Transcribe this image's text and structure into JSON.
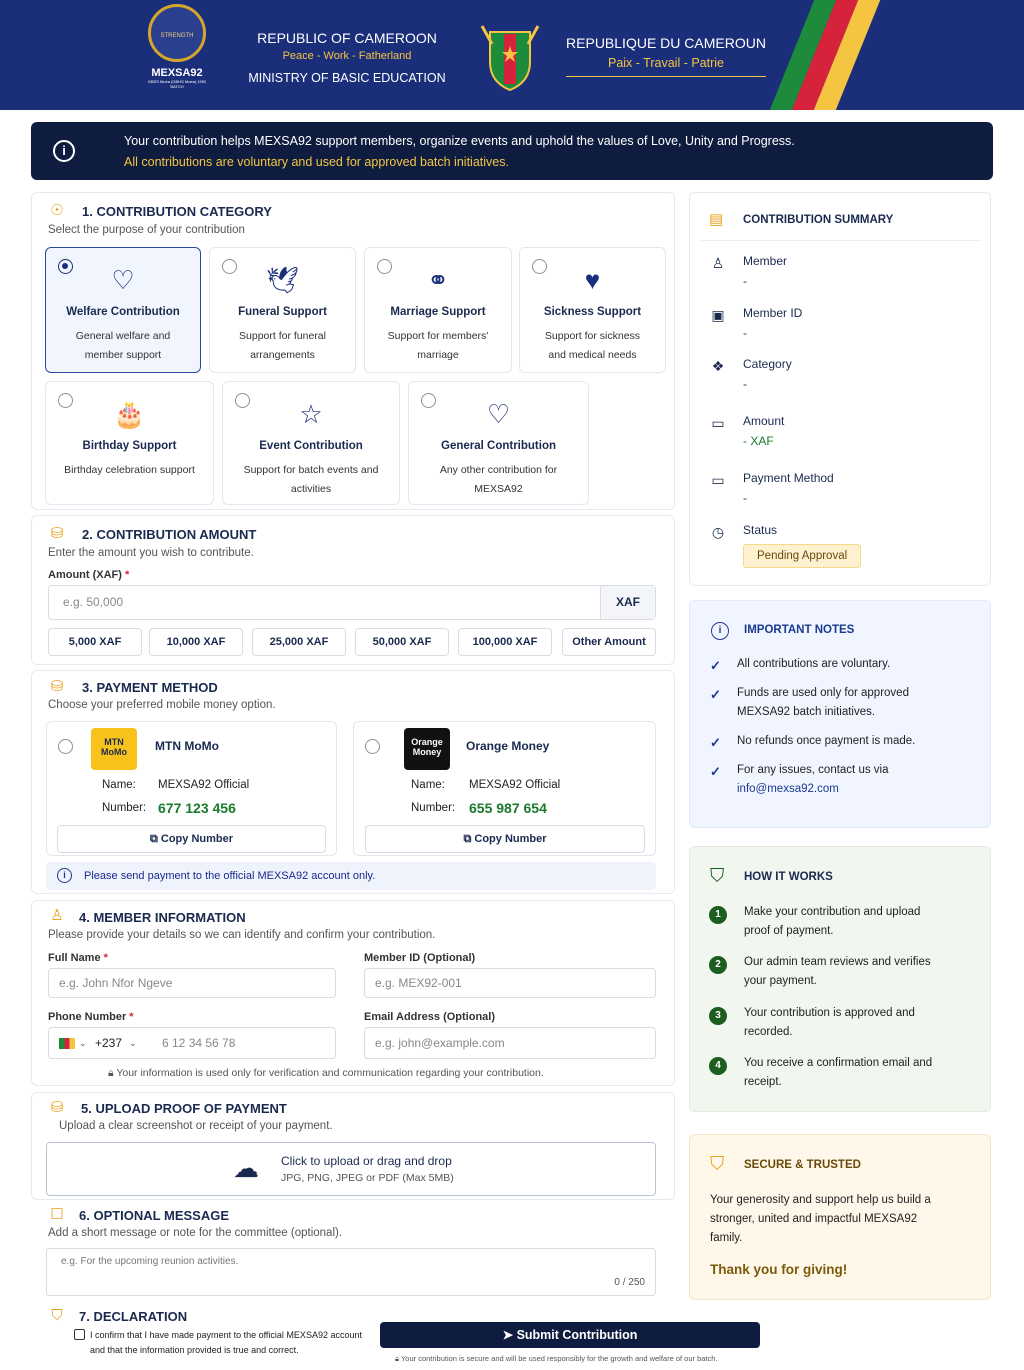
{
  "header": {
    "logo_text": "MEXSA92",
    "logo_sub": "GBSS Muea (GBHS Muea) 1992 BATCH",
    "badge_text": "STRENGTH",
    "en_title": "REPUBLIC OF CAMEROON",
    "en_motto": "Peace - Work - Fatherland",
    "ministry": "MINISTRY OF BASIC EDUCATION",
    "fr_title": "REPUBLIQUE DU CAMEROUN",
    "fr_motto": "Paix - Travail - Patrie",
    "flag_colors": [
      "#1e8a3c",
      "#d6223a",
      "#f5c542"
    ]
  },
  "alert": {
    "icon": "info-icon",
    "line1": "Your contribution helps MEXSA92 support members, organize events and uphold the values of Love, Unity and Progress.",
    "line2": "All contributions are voluntary and used for approved batch initiatives."
  },
  "s1": {
    "title": "1. CONTRIBUTION CATEGORY",
    "subtitle": "Select the purpose of your contribution",
    "categories": [
      {
        "name": "Welfare Contribution",
        "desc": "General welfare and member support",
        "icon": "people-heart-icon",
        "selected": true
      },
      {
        "name": "Funeral Support",
        "desc": "Support for funeral arrangements",
        "icon": "dove-icon"
      },
      {
        "name": "Marriage Support",
        "desc": "Support for members' marriage",
        "icon": "rings-icon"
      },
      {
        "name": "Sickness Support",
        "desc": "Support for sickness and medical needs",
        "icon": "heart-plus-icon"
      },
      {
        "name": "Birthday Support",
        "desc": "Birthday celebration support",
        "icon": "cake-icon"
      },
      {
        "name": "Event Contribution",
        "desc": "Support for batch events and activities",
        "icon": "calendar-star-icon"
      },
      {
        "name": "General Contribution",
        "desc": "Any other contribution for MEXSA92",
        "icon": "hands-heart-icon"
      }
    ]
  },
  "s2": {
    "title": "2. CONTRIBUTION AMOUNT",
    "subtitle": "Enter the amount you wish to contribute.",
    "label": "Amount (XAF)",
    "placeholder": "e.g. 50,000",
    "suffix": "XAF",
    "chips": [
      "5,000 XAF",
      "10,000 XAF",
      "25,000 XAF",
      "50,000 XAF",
      "100,000 XAF",
      "Other Amount"
    ]
  },
  "s3": {
    "title": "3. PAYMENT METHOD",
    "subtitle": "Choose your preferred mobile money option.",
    "name_key": "Name:",
    "number_key": "Number:",
    "copy": "Copy Number",
    "mtn": {
      "logo": "MTN MoMo",
      "name": "MTN MoMo",
      "account": "MEXSA92 Official",
      "number": "677 123 456"
    },
    "orange": {
      "logo": "Orange Money",
      "name": "Orange Money",
      "account": "MEXSA92 Official",
      "number": "655 987 654"
    },
    "note": "Please send payment to the official MEXSA92 account only."
  },
  "s4": {
    "title": "4. MEMBER INFORMATION",
    "subtitle": "Please provide your details so we can identify and confirm your contribution.",
    "fullname_label": "Full Name",
    "fullname_ph": "e.g. John Nfor Ngeve",
    "memberid_label": "Member ID (Optional)",
    "memberid_ph": "e.g. MEX92-001",
    "phone_label": "Phone Number",
    "phone_code": "+237",
    "phone_ph": "6 12 34 56 78",
    "email_label": "Email Address (Optional)",
    "email_ph": "e.g. john@example.com",
    "privacy": "Your information is used only for verification and communication regarding your contribution."
  },
  "s5": {
    "title": "5. UPLOAD PROOF OF PAYMENT",
    "subtitle": "Upload a clear screenshot or receipt of your payment.",
    "drop": "Click to upload or drag and drop",
    "formats": "JPG, PNG, JPEG or PDF (Max 5MB)"
  },
  "s6": {
    "title": "6. OPTIONAL MESSAGE",
    "subtitle": "Add a short message or note for the committee (optional).",
    "placeholder": "e.g. For the upcoming reunion activities.",
    "counter": "0 / 250"
  },
  "s7": {
    "title": "7. DECLARATION",
    "text1": "I confirm that I have made payment to the official MEXSA92 account",
    "text2": "and that the information provided is true and correct."
  },
  "submit": {
    "label": "Submit Contribution",
    "note": "Your contribution is secure and will be used responsibly for the growth and welfare of our batch."
  },
  "summary": {
    "title": "CONTRIBUTION SUMMARY",
    "rows": [
      {
        "key": "Member",
        "val": "-",
        "icon": "user-icon"
      },
      {
        "key": "Member ID",
        "val": "-",
        "icon": "id-card-icon"
      },
      {
        "key": "Category",
        "val": "-",
        "icon": "category-icon"
      },
      {
        "key": "Amount",
        "val": "- XAF",
        "icon": "money-icon"
      },
      {
        "key": "Payment Method",
        "val": "-",
        "icon": "card-icon"
      },
      {
        "key": "Status",
        "val": "",
        "icon": "clock-icon"
      }
    ],
    "status": "Pending Approval"
  },
  "notes": {
    "title": "IMPORTANT NOTES",
    "items": [
      "All contributions are voluntary.",
      "Funds are used only for approved MEXSA92 batch initiatives.",
      "No refunds once payment is made.",
      "For any issues, contact us via"
    ],
    "email": "info@mexsa92.com"
  },
  "how": {
    "title": "HOW IT WORKS",
    "steps": [
      "Make your contribution and upload proof of payment.",
      "Our admin team reviews and verifies your payment.",
      "Your contribution is approved and recorded.",
      "You receive a confirmation email and receipt."
    ]
  },
  "secure": {
    "title": "SECURE & TRUSTED",
    "text": "Your generosity and support help us build a stronger, united and impactful MEXSA92 family.",
    "thanks": "Thank you for giving!"
  }
}
